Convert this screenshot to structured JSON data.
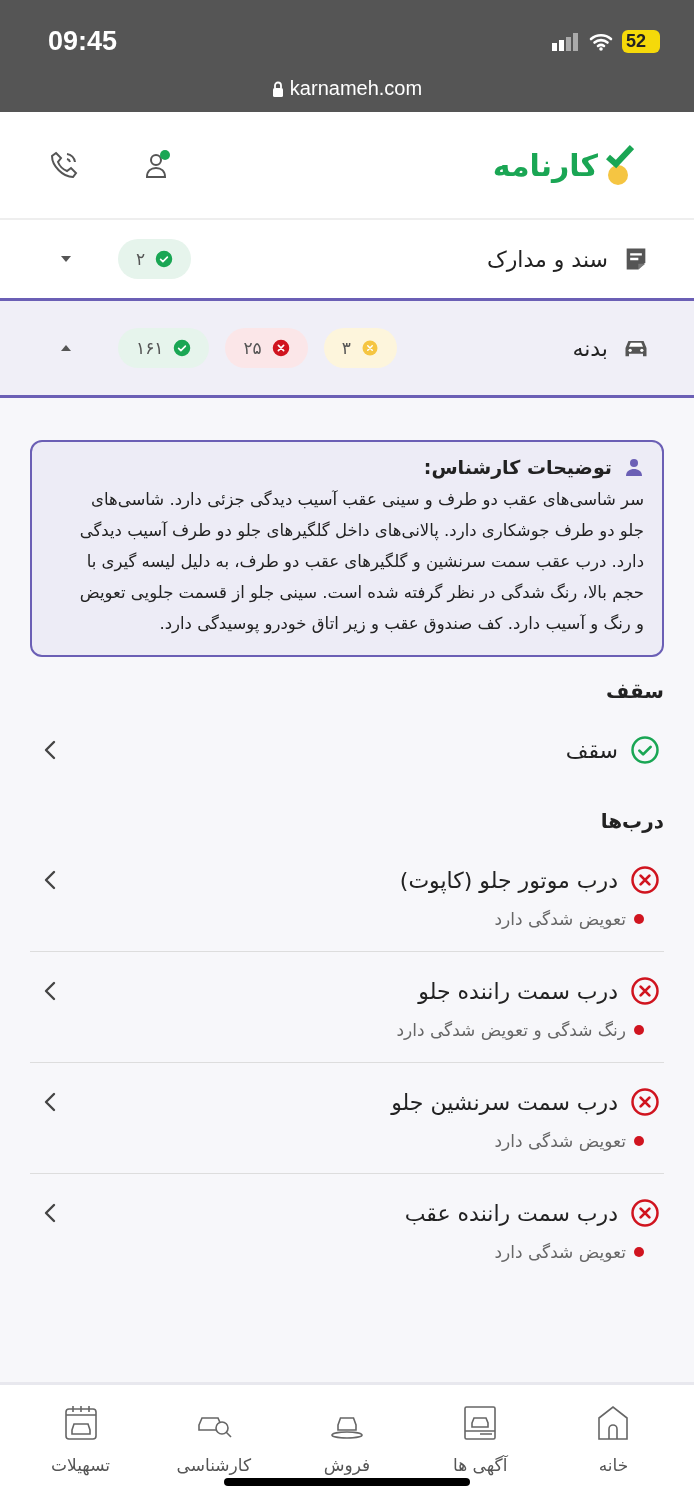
{
  "status_bar": {
    "time": "09:45",
    "battery": "52",
    "url": "karnameh.com"
  },
  "header": {
    "logo_text": "کارنامه"
  },
  "categories": [
    {
      "title": "سند و مدارک",
      "expanded": false,
      "badges": [
        {
          "kind": "ok",
          "count": "۲"
        }
      ]
    },
    {
      "title": "بدنه",
      "expanded": true,
      "badges": [
        {
          "kind": "warn",
          "count": "۳"
        },
        {
          "kind": "fail",
          "count": "۲۵"
        },
        {
          "kind": "ok",
          "count": "۱۶۱"
        }
      ]
    }
  ],
  "expert_note": {
    "title": "توضیحات کارشناس:",
    "text": "سر شاسی‌های عقب دو طرف و سینی عقب آسیب دیدگی جزئی دارد. شاسی‌های جلو دو طرف جوشکاری دارد. پالانی‌های داخل گلگیرهای جلو دو طرف آسیب دیدگی دارد. درب عقب سمت سرنشین و گلگیرهای عقب دو طرف، به دلیل لیسه گیری با حجم بالا، رنگ شدگی در نظر گرفته شده است. سینی جلو از قسمت جلویی تعویض و رنگ و آسیب دارد. کف صندوق عقب و زیر اتاق خودرو پوسیدگی دارد."
  },
  "groups": [
    {
      "title": "سقف",
      "items": [
        {
          "name": "سقف",
          "kind": "ok"
        }
      ]
    },
    {
      "title": "درب‌ها",
      "items": [
        {
          "name": "درب موتور جلو (کاپوت)",
          "kind": "fail",
          "note": "تعویض شدگی دارد"
        },
        {
          "name": "درب سمت راننده جلو",
          "kind": "fail",
          "note": "رنگ شدگی و تعویض شدگی دارد"
        },
        {
          "name": "درب سمت سرنشین جلو",
          "kind": "fail",
          "note": "تعویض شدگی دارد"
        },
        {
          "name": "درب سمت راننده عقب",
          "kind": "fail",
          "note": "تعویض شدگی دارد"
        }
      ]
    }
  ],
  "bottom_nav": [
    {
      "label": "خانه"
    },
    {
      "label": "آگهی ها"
    },
    {
      "label": "فروش"
    },
    {
      "label": "کارشناسی"
    },
    {
      "label": "تسهیلات"
    }
  ]
}
